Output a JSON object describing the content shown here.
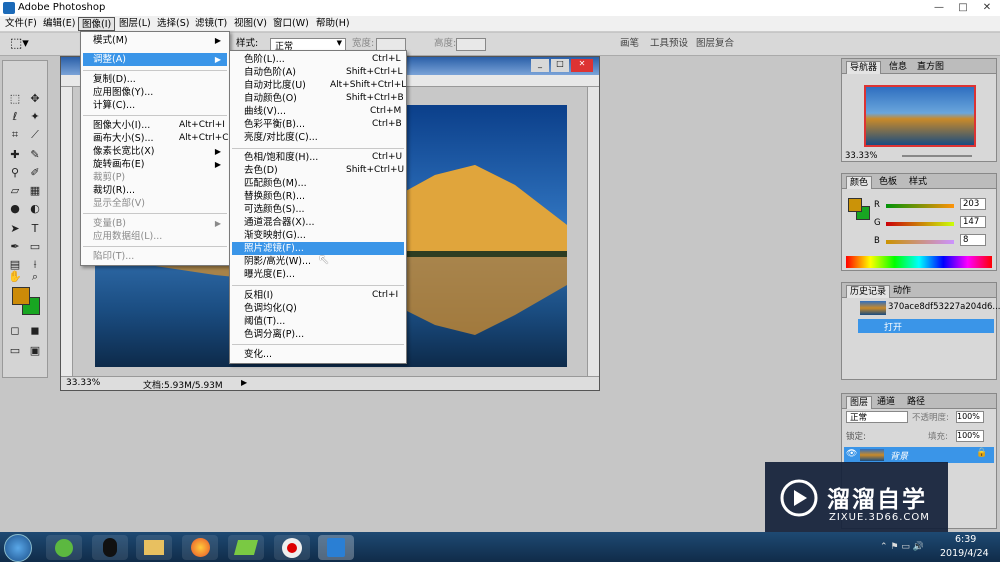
{
  "app": {
    "title": "Adobe Photoshop"
  },
  "window_controls": {
    "minimize": "—",
    "maximize": "□",
    "close": "✕"
  },
  "menubar": [
    "文件(F)",
    "编辑(E)",
    "图像(I)",
    "图层(L)",
    "选择(S)",
    "滤镜(T)",
    "视图(V)",
    "窗口(W)",
    "帮助(H)"
  ],
  "options": {
    "style_label": "样式:",
    "style_value": "正常",
    "width_label": "宽度:",
    "height_label": "高度:",
    "dock": [
      "画笔",
      "工具预设",
      "图层复合"
    ]
  },
  "image_menu": [
    {
      "label": "模式(M)",
      "sub": true
    },
    {
      "label": "调整(A)",
      "sub": true,
      "hl": true
    },
    {
      "sep": true
    },
    {
      "label": "复制(D)..."
    },
    {
      "label": "应用图像(Y)..."
    },
    {
      "label": "计算(C)..."
    },
    {
      "sep": true
    },
    {
      "label": "图像大小(I)...",
      "sc": "Alt+Ctrl+I"
    },
    {
      "label": "画布大小(S)...",
      "sc": "Alt+Ctrl+C"
    },
    {
      "label": "像素长宽比(X)",
      "sub": true
    },
    {
      "label": "旋转画布(E)",
      "sub": true
    },
    {
      "label": "裁剪(P)",
      "dis": true
    },
    {
      "label": "裁切(R)..."
    },
    {
      "label": "显示全部(V)",
      "dis": true
    },
    {
      "sep": true
    },
    {
      "label": "变量(B)",
      "sub": true,
      "dis": true
    },
    {
      "label": "应用数据组(L)...",
      "dis": true
    },
    {
      "sep": true
    },
    {
      "label": "陷印(T)...",
      "dis": true
    }
  ],
  "adjust_menu": [
    {
      "label": "色阶(L)...",
      "sc": "Ctrl+L"
    },
    {
      "label": "自动色阶(A)",
      "sc": "Shift+Ctrl+L"
    },
    {
      "label": "自动对比度(U)",
      "sc": "Alt+Shift+Ctrl+L"
    },
    {
      "label": "自动颜色(O)",
      "sc": "Shift+Ctrl+B"
    },
    {
      "label": "曲线(V)...",
      "sc": "Ctrl+M"
    },
    {
      "label": "色彩平衡(B)...",
      "sc": "Ctrl+B"
    },
    {
      "label": "亮度/对比度(C)..."
    },
    {
      "sep": true
    },
    {
      "label": "色相/饱和度(H)...",
      "sc": "Ctrl+U"
    },
    {
      "label": "去色(D)",
      "sc": "Shift+Ctrl+U"
    },
    {
      "label": "匹配颜色(M)..."
    },
    {
      "label": "替换颜色(R)..."
    },
    {
      "label": "可选颜色(S)..."
    },
    {
      "label": "通道混合器(X)..."
    },
    {
      "label": "渐变映射(G)..."
    },
    {
      "label": "照片滤镜(F)...",
      "hl": true
    },
    {
      "label": "阴影/高光(W)..."
    },
    {
      "label": "曝光度(E)..."
    },
    {
      "sep": true
    },
    {
      "label": "反相(I)",
      "sc": "Ctrl+I"
    },
    {
      "label": "色调均化(Q)"
    },
    {
      "label": "阈值(T)..."
    },
    {
      "label": "色调分离(P)..."
    },
    {
      "sep": true
    },
    {
      "label": "变化..."
    }
  ],
  "doc": {
    "zoom": "33.33%",
    "info": "文档:5.93M/5.93M"
  },
  "navigator": {
    "tabs": [
      "导航器",
      "信息",
      "直方图"
    ],
    "zoom": "33.33%"
  },
  "color": {
    "tabs": [
      "颜色",
      "色板",
      "样式"
    ],
    "channels": [
      {
        "label": "R",
        "value": "203"
      },
      {
        "label": "G",
        "value": "147"
      },
      {
        "label": "B",
        "value": "8"
      }
    ],
    "fg": "#cb9308",
    "bg": "#18a622"
  },
  "history": {
    "tabs": [
      "历史记录",
      "动作"
    ],
    "snapshot": "370ace8df53227a204d6...",
    "step": "打开"
  },
  "layers": {
    "tabs": [
      "图层",
      "通道",
      "路径"
    ],
    "blend": "正常",
    "opacity_label": "不透明度:",
    "opacity": "100%",
    "lock_label": "锁定:",
    "fill_label": "填充:",
    "fill": "100%",
    "layer_name": "背景"
  },
  "watermark": {
    "brand": "溜溜自学",
    "url": "ZIXUE.3D66.COM"
  },
  "clock": {
    "time": "6:39",
    "date": "2019/4/24"
  }
}
